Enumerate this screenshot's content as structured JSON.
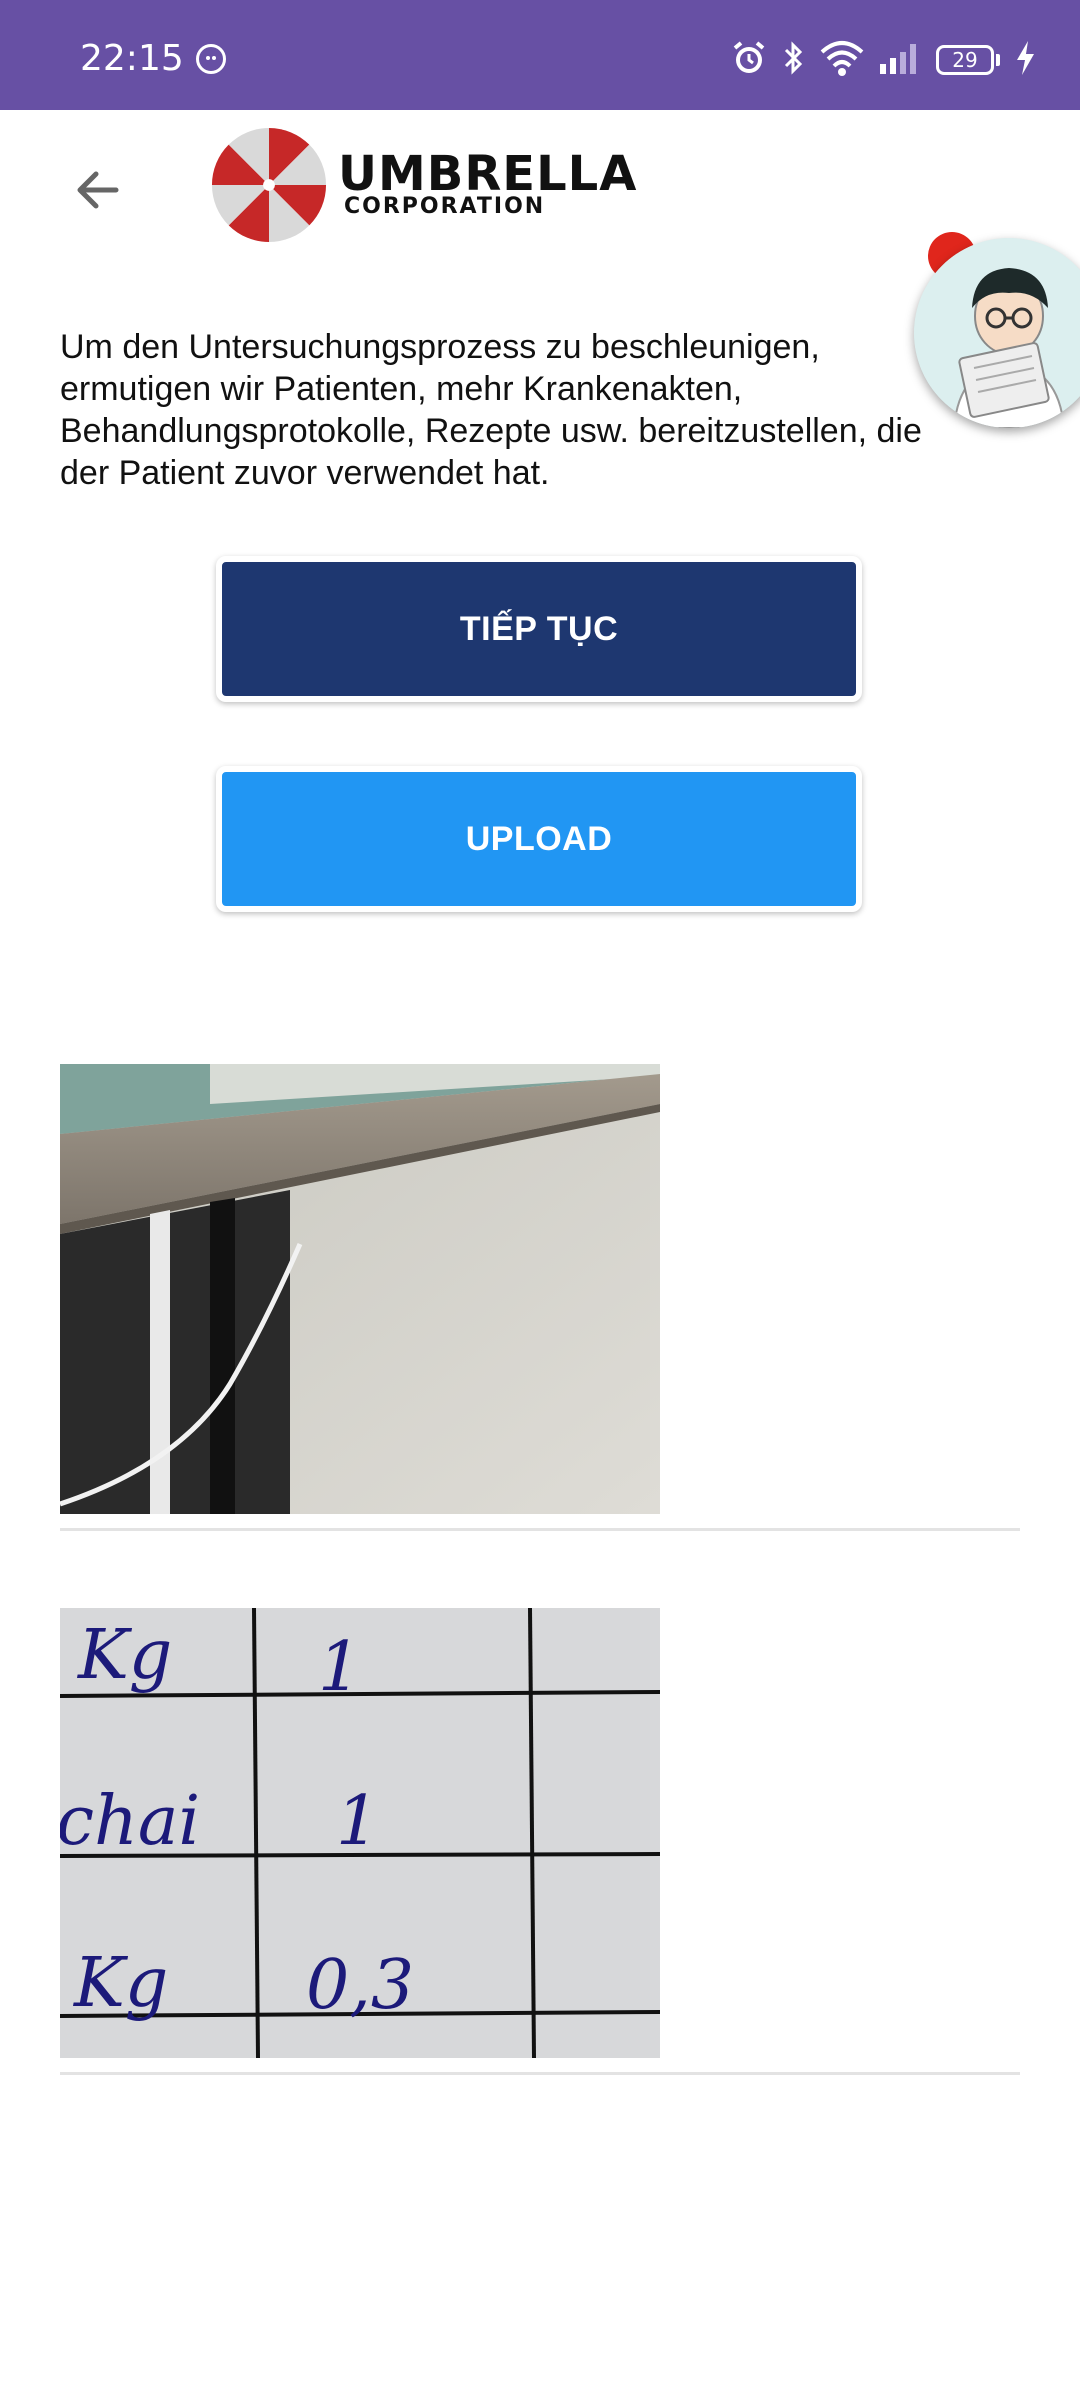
{
  "status_bar": {
    "time": "22:15",
    "battery": "29",
    "icons": [
      "face-icon",
      "alarm-icon",
      "bluetooth-icon",
      "wifi-icon",
      "signal-icon",
      "battery-icon",
      "charging-icon"
    ]
  },
  "header": {
    "back_icon": "arrow-left-icon",
    "logo_main": "UMBRELLA",
    "logo_sub": "CORPORATION"
  },
  "description": "Um den Untersuchungsprozess zu beschleunigen, ermutigen wir Patienten, mehr Krankenakten, Behandlungsprotokolle, Rezepte usw. bereitzustellen, die der Patient zuvor verwendet hat.",
  "buttons": {
    "continue_label": "TIẾP TỤC",
    "upload_label": "UPLOAD"
  },
  "colors": {
    "status_bar": "#6750a4",
    "continue_button": "#1e3770",
    "upload_button": "#2196f3",
    "badge": "#e0261c",
    "logo_red": "#c62828"
  },
  "uploaded_images": [
    {
      "kind": "photo-shelf-cable"
    },
    {
      "kind": "photo-handwritten-table",
      "rows": [
        {
          "unit": "Kg",
          "qty": "1"
        },
        {
          "unit": "chai",
          "qty": "1"
        },
        {
          "unit": "Kg",
          "qty": "0,3"
        }
      ]
    }
  ]
}
